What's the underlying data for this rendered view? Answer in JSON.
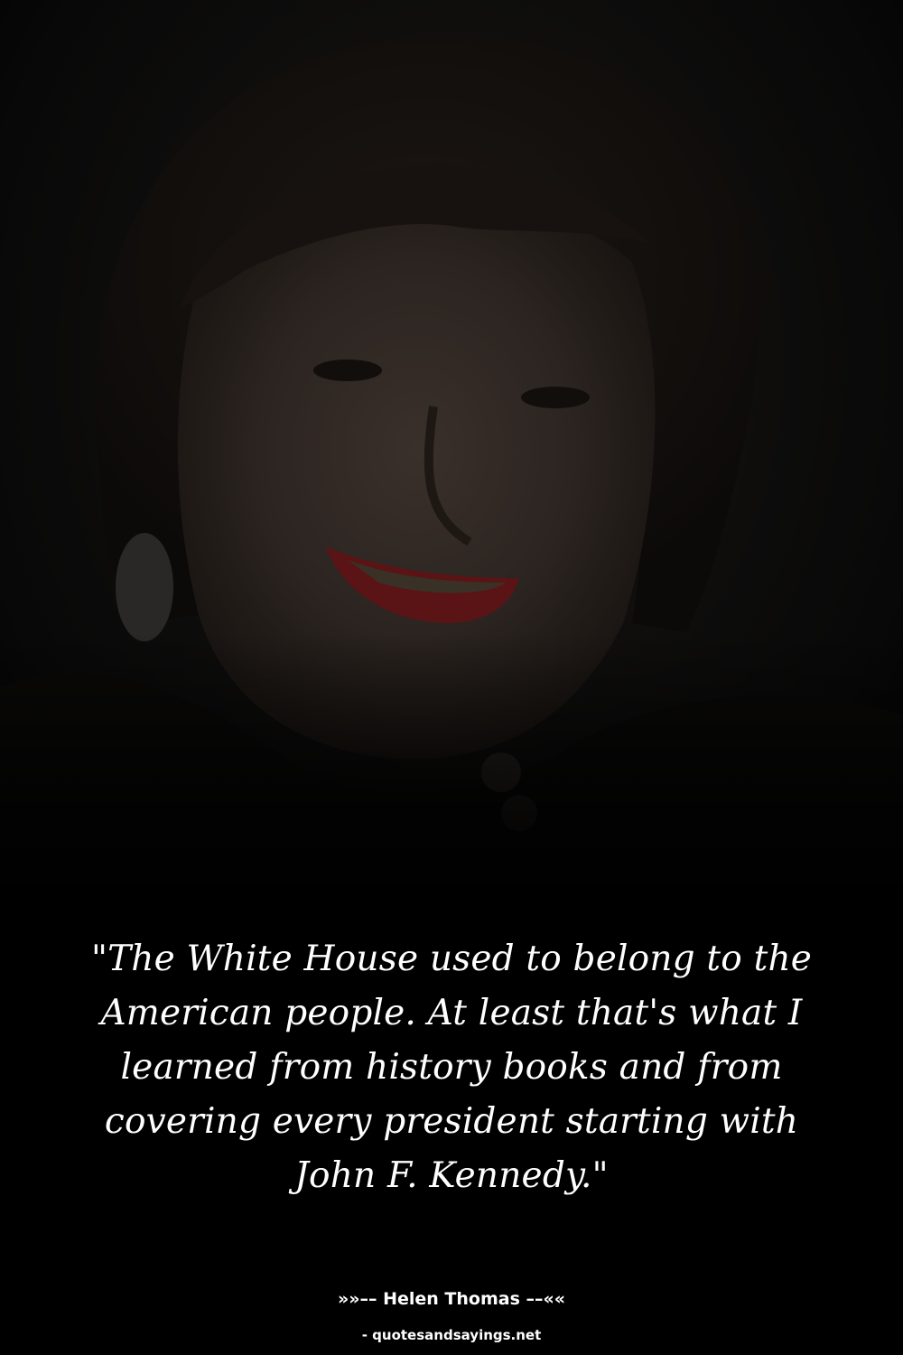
{
  "quote": {
    "text": "\"The White House used to belong to the American people. At least that's what I learned from history books and from covering every president starting with John F. Kennedy.\""
  },
  "author": {
    "line": "»»–– Helen Thomas ––««"
  },
  "source": {
    "text": "- quotesandsayings.net"
  },
  "photo": {
    "subject": "portrait-photo"
  }
}
